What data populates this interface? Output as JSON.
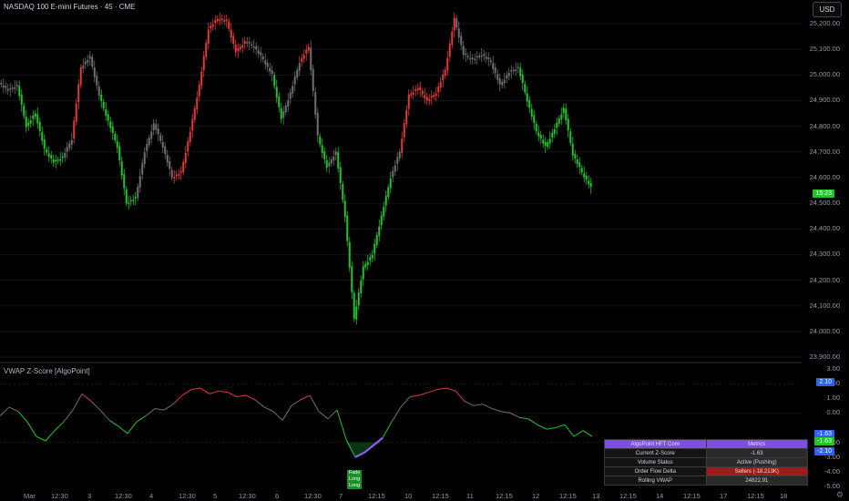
{
  "header": {
    "title": "NASDAQ 100 E-mini Futures · 45 · CME",
    "currency_button": "USD"
  },
  "indicator": {
    "title": "VWAP Z-Score [AlgoPoint]"
  },
  "price_axis": {
    "labels": [
      "25,200.00",
      "25,100.00",
      "25,000.00",
      "24,900.00",
      "24,800.00",
      "24,700.00",
      "24,600.00",
      "24,500.00",
      "24,400.00",
      "24,300.00",
      "24,200.00",
      "24,100.00",
      "24,000.00",
      "23,900.00"
    ],
    "current_badge": "15:23",
    "current_badge_color": "#22c32e"
  },
  "zscore_axis": {
    "labels": [
      "3.00",
      "2.00",
      "1.00",
      "0.00",
      "-2.00",
      "-3.00",
      "-4.00",
      "-5.00"
    ],
    "badges": [
      {
        "text": "2.10",
        "color": "#2962ff"
      },
      {
        "text": "-1.63",
        "color": "#2962ff"
      },
      {
        "text": "-1.63",
        "color": "#22c32e"
      },
      {
        "text": "-2.10",
        "color": "#2962ff"
      }
    ]
  },
  "time_axis": {
    "labels": [
      "Mar",
      "12:30",
      "3",
      "12:30",
      "4",
      "12:30",
      "5",
      "12:30",
      "6",
      "12:30",
      "7",
      "12:15",
      "10",
      "12:15",
      "11",
      "12:15",
      "12",
      "12:15",
      "13",
      "12:15",
      "14",
      "12:15",
      "17",
      "12:15",
      "18"
    ]
  },
  "table": {
    "header": [
      "AlgoPoint HFT Core",
      "Metrics"
    ],
    "rows": [
      {
        "label": "Current Z-Score",
        "value": "-1.63",
        "style": "normal"
      },
      {
        "label": "Volume Status",
        "value": "Active (Pushing)",
        "style": "normal"
      },
      {
        "label": "Order Flow Delta",
        "value": "Sellers (-18.213K)",
        "style": "sellers"
      },
      {
        "label": "Rolling VWAP",
        "value": "24822.91",
        "style": "normal"
      }
    ]
  },
  "signal": {
    "lines": [
      "Fade",
      "Long",
      "Long"
    ]
  },
  "colors": {
    "bull": "#22c32e",
    "bear": "#e03a3a",
    "neutral": "#6f6f6f",
    "signal_line": "#8a5cf0",
    "badge_blue": "#2962ff"
  },
  "chart_data": {
    "type": "candlestick",
    "x_range": [
      0,
      660
    ],
    "y_range": [
      23900,
      25250
    ],
    "ohlc_x_close": {
      "x": [
        0,
        10,
        20,
        30,
        40,
        50,
        60,
        70,
        80,
        90,
        100,
        110,
        120,
        130,
        140,
        150,
        160,
        170,
        180,
        190,
        200,
        210,
        220,
        230,
        240,
        250,
        260,
        270,
        280,
        290,
        300,
        310,
        320,
        330,
        340,
        350,
        360,
        370,
        380,
        390,
        400,
        410,
        420,
        430,
        440,
        450,
        460,
        470,
        480,
        490,
        500,
        510,
        520,
        530,
        540,
        550,
        560,
        570,
        580,
        590,
        600,
        610,
        620,
        630,
        640,
        650
      ],
      "close": [
        24970,
        24940,
        24960,
        24800,
        24850,
        24710,
        24660,
        24680,
        24750,
        25030,
        25070,
        24920,
        24820,
        24720,
        24500,
        24520,
        24700,
        24810,
        24720,
        24600,
        24620,
        24780,
        24960,
        25180,
        25220,
        25210,
        25090,
        25130,
        25110,
        25060,
        25000,
        24830,
        24930,
        25050,
        25110,
        24760,
        24640,
        24700,
        24450,
        24050,
        24250,
        24300,
        24450,
        24600,
        24700,
        24920,
        24950,
        24900,
        24930,
        25020,
        25220,
        25080,
        25060,
        25080,
        25050,
        24960,
        25010,
        25030,
        24900,
        24780,
        24720,
        24790,
        24870,
        24690,
        24620,
        24560
      ]
    },
    "zscore": {
      "x": [
        0,
        10,
        20,
        30,
        40,
        50,
        60,
        70,
        80,
        90,
        100,
        110,
        120,
        130,
        140,
        150,
        160,
        170,
        180,
        190,
        200,
        210,
        220,
        230,
        240,
        250,
        260,
        270,
        280,
        290,
        300,
        310,
        320,
        330,
        340,
        350,
        360,
        370,
        380,
        390,
        400,
        410,
        420,
        430,
        440,
        450,
        460,
        470,
        480,
        490,
        500,
        510,
        520,
        530,
        540,
        550,
        560,
        570,
        580,
        590,
        600,
        610,
        620,
        630,
        640,
        650
      ],
      "values": [
        -0.2,
        0.4,
        0.1,
        -0.6,
        -1.6,
        -1.9,
        -1.2,
        -0.6,
        0.2,
        1.3,
        0.8,
        0.2,
        -0.5,
        -0.9,
        -1.4,
        -0.6,
        -0.2,
        0.3,
        0.2,
        0.6,
        1.2,
        1.6,
        1.7,
        1.3,
        1.5,
        1.4,
        1.1,
        1.2,
        0.9,
        0.4,
        0.1,
        -0.5,
        0.5,
        0.9,
        1.2,
        0.1,
        -0.4,
        0.2,
        -1.8,
        -3.0,
        -2.7,
        -2.2,
        -1.7,
        -0.6,
        0.4,
        1.1,
        1.2,
        1.4,
        1.6,
        1.7,
        1.5,
        0.8,
        0.5,
        0.6,
        0.3,
        0.1,
        0.0,
        -0.3,
        -0.4,
        -0.8,
        -1.1,
        -1.0,
        -0.8,
        -1.6,
        -1.2,
        -1.6
      ]
    }
  }
}
